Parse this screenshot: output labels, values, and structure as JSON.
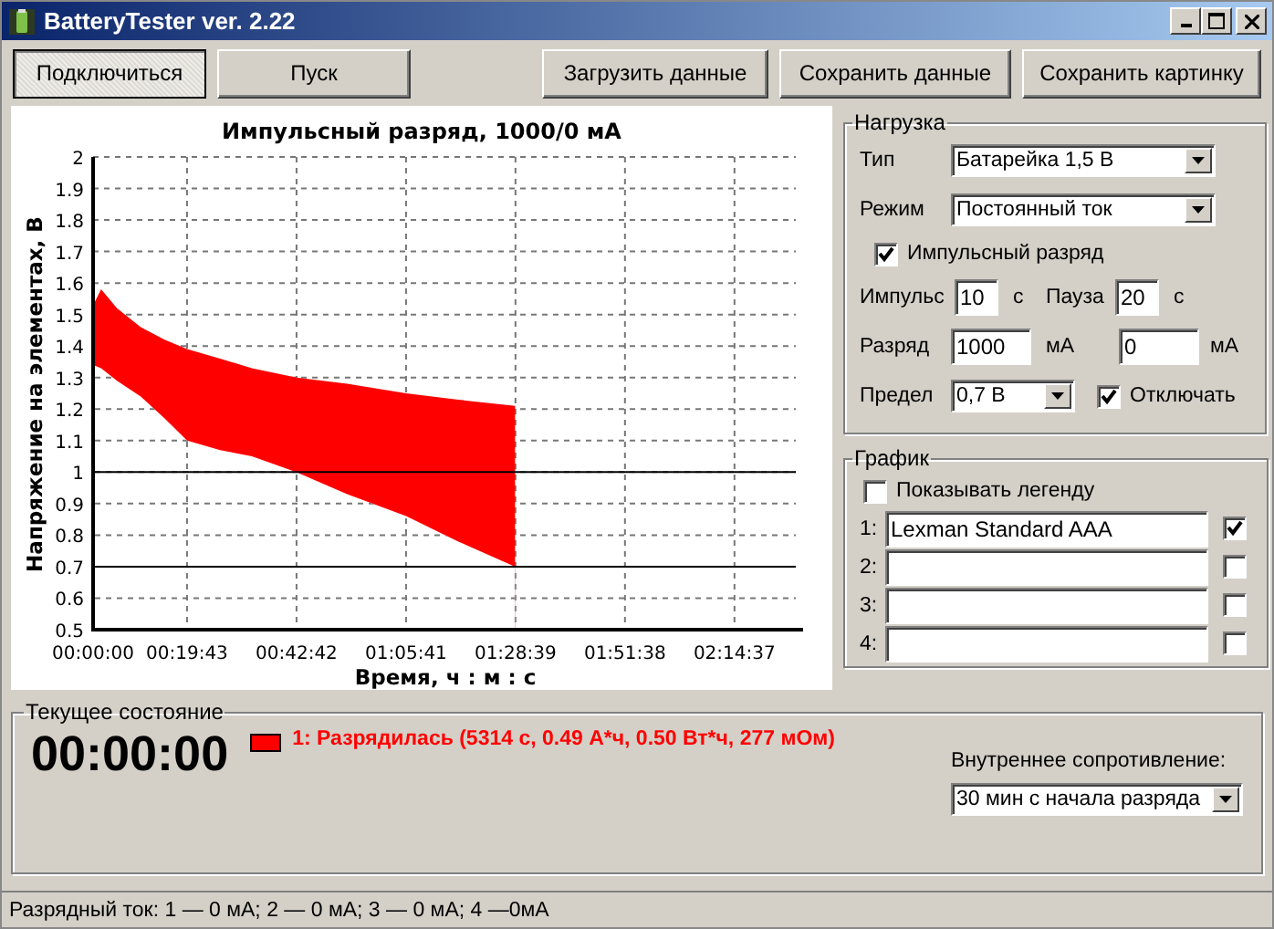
{
  "window": {
    "title": "BatteryTester ver. 2.22"
  },
  "toolbar": {
    "buttons": [
      {
        "label": "Подключиться",
        "pressed": true
      },
      {
        "label": "Пуск",
        "pressed": false
      },
      {
        "label": "Загрузить данные",
        "pressed": false
      },
      {
        "label": "Сохранить данные",
        "pressed": false
      },
      {
        "label": "Сохранить картинку",
        "pressed": false
      }
    ]
  },
  "chart_data": {
    "type": "area",
    "title": "Импульсный разряд, 1000/0 мА",
    "xlabel": "Время, ч : м : с",
    "ylabel": "Напряжение на элементах, В",
    "x": [
      0,
      100,
      300,
      600,
      900,
      1183,
      1600,
      2000,
      2562,
      3200,
      3941,
      4600,
      5314
    ],
    "series": [
      {
        "color": "#ff0000",
        "values": [
          1.53,
          1.58,
          1.52,
          1.46,
          1.42,
          1.39,
          1.36,
          1.33,
          1.3,
          1.28,
          1.25,
          1.23,
          1.21
        ]
      },
      {
        "color": "#ffffff",
        "values": [
          1.34,
          1.33,
          1.29,
          1.24,
          1.17,
          1.1,
          1.07,
          1.05,
          1.0,
          0.93,
          0.86,
          0.78,
          0.7
        ]
      }
    ],
    "xlim": [
      0,
      8849
    ],
    "ylim": [
      0.5,
      2
    ],
    "xticks": [
      {
        "value": 0,
        "label": "00:00:00"
      },
      {
        "value": 1183,
        "label": "00:19:43"
      },
      {
        "value": 2562,
        "label": "00:42:42"
      },
      {
        "value": 3941,
        "label": "01:05:41"
      },
      {
        "value": 5319,
        "label": "01:28:39"
      },
      {
        "value": 6698,
        "label": "01:51:38"
      },
      {
        "value": 8077,
        "label": "02:14:37"
      }
    ],
    "yticks": [
      0.5,
      0.6,
      0.7,
      0.8,
      0.9,
      1,
      1.1,
      1.2,
      1.3,
      1.4,
      1.5,
      1.6,
      1.7,
      1.8,
      1.9,
      2
    ],
    "grid": true
  },
  "load": {
    "title": "Нагрузка",
    "type": {
      "label": "Тип",
      "value": "Батарейка 1,5 В"
    },
    "mode": {
      "label": "Режим",
      "value": "Постоянный ток"
    },
    "pulse_mode": {
      "label": "Импульсный разряд",
      "checked": true
    },
    "pulse": {
      "label": "Импульс",
      "value": "10",
      "unit": "с"
    },
    "pause": {
      "label": "Пауза",
      "value": "20",
      "unit": "с"
    },
    "discharge": {
      "label": "Разряд",
      "value": "1000",
      "unit": "мА",
      "value_2": "0",
      "unit_2": "мА"
    },
    "limit": {
      "label": "Предел",
      "value": "0,7 В"
    },
    "cutoff": {
      "label": "Отключать",
      "checked": true
    }
  },
  "graph": {
    "title": "График",
    "show_legend": {
      "label": "Показывать легенду",
      "checked": false
    },
    "slots": [
      {
        "index": "1:",
        "value": "Lexman Standard AAA",
        "checked": true
      },
      {
        "index": "2:",
        "checked": false
      },
      {
        "index": "3:",
        "checked": false
      },
      {
        "index": "4:",
        "checked": false
      }
    ]
  },
  "state": {
    "title": "Текущее состояние",
    "timer": "00:00:00",
    "result": {
      "color": "#ff0000",
      "text": "1: Разрядилась (5314 с, 0.49 А*ч, 0.50 Вт*ч, 277 мОм)"
    },
    "resistance": {
      "label": "Внутреннее сопротивление:",
      "value": "30 мин с начала разряда"
    }
  },
  "status_bar": "Разрядный ток: 1 — 0 мА; 2 — 0 мА; 3 — 0 мА; 4  —0мА"
}
